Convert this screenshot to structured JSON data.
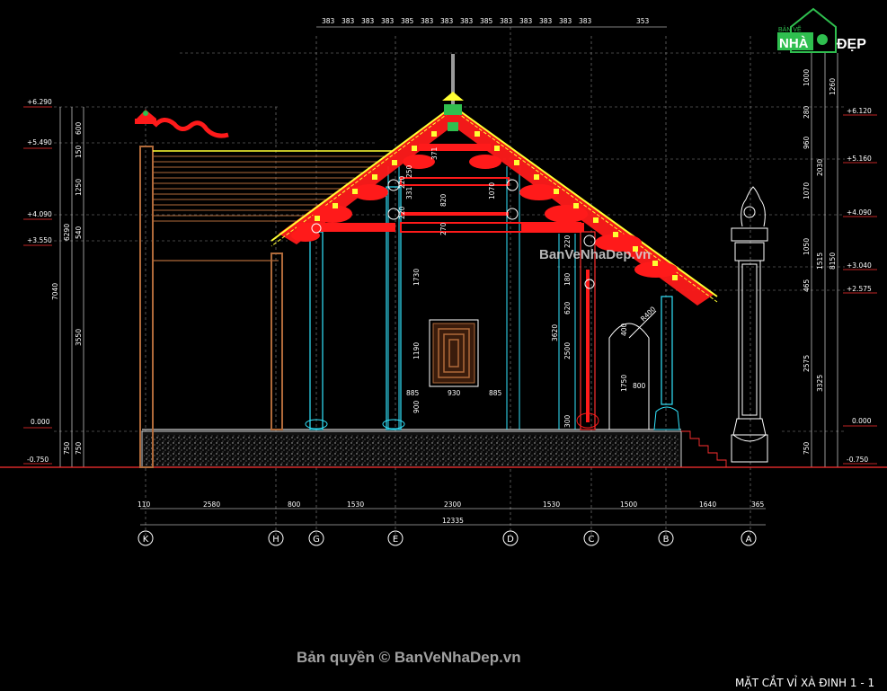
{
  "logo": {
    "small_text": "BẢN VẼ",
    "nha_text": "NHÀ",
    "dep_text": "ĐẸP"
  },
  "watermark_mid": "BanVeNhaDep.vn",
  "copyright": "Bản quyền © BanVeNhaDep.vn",
  "drawing_title": "MẶT CẮT VỈ XÀ ĐINH 1 - 1",
  "top_dims": [
    "383",
    "383",
    "383",
    "383",
    "385",
    "383",
    "383",
    "383",
    "385",
    "383",
    "383",
    "383",
    "383",
    "383",
    "353"
  ],
  "left_levels": [
    "+6.290",
    "+5.490",
    "+4.090",
    "+3.550",
    "0.000",
    "-0.750"
  ],
  "right_levels": [
    "+6.120",
    "+5.160",
    "+4.090",
    "+3.040",
    "+2.575",
    "0.000",
    "-0.750"
  ],
  "left_dims_inner": [
    "600",
    "150",
    "1250",
    "540",
    "3550",
    "750"
  ],
  "left_dims_outer": [
    "6290",
    "7040",
    "750"
  ],
  "right_dims_inner": [
    "1000",
    "280",
    "960",
    "1070",
    "1050",
    "465",
    "2575",
    "750"
  ],
  "right_dims_mid": [
    "2030",
    "1515",
    "3325"
  ],
  "right_dims_outer": [
    "1260",
    "8150"
  ],
  "inner_dims": [
    "371",
    "250",
    "220",
    "331",
    "220",
    "820",
    "1070",
    "270",
    "1730",
    "1190",
    "885",
    "930",
    "885",
    "900",
    "3620",
    "2500",
    "300",
    "220",
    "180",
    "620",
    "400",
    "1750",
    "800",
    "R400"
  ],
  "bottom_dims": [
    "110",
    "2580",
    "800",
    "1530",
    "2300",
    "1530",
    "1500",
    "1640",
    "365"
  ],
  "bottom_total": "12335",
  "axes": [
    "K",
    "H",
    "G",
    "E",
    "D",
    "C",
    "B",
    "A"
  ],
  "colors": {
    "roof_red": "#ff1a1a",
    "beam_yellow": "#ffff33",
    "column_cyan": "#33e6ff",
    "grid_grey": "#9a9a9a",
    "wood_brown": "#b06a3a",
    "ground_red": "#ff3030"
  }
}
